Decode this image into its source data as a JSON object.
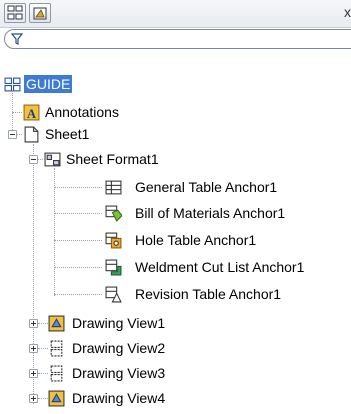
{
  "header": {
    "close_glyph": "x"
  },
  "tree": {
    "root": "GUIDE",
    "annotations": "Annotations",
    "sheet1": "Sheet1",
    "sheet_format": "Sheet Format1",
    "anchors": [
      {
        "label": "General Table Anchor1",
        "icon": "general-table-icon"
      },
      {
        "label": "Bill of Materials Anchor1",
        "icon": "bom-icon"
      },
      {
        "label": "Hole Table Anchor1",
        "icon": "hole-table-icon"
      },
      {
        "label": "Weldment Cut List Anchor1",
        "icon": "weldment-icon"
      },
      {
        "label": "Revision Table Anchor1",
        "icon": "revision-table-icon"
      }
    ],
    "views": [
      {
        "label": "Drawing View1",
        "icon": "drawing-view-icon"
      },
      {
        "label": "Drawing View2",
        "icon": "drawing-view-broken-icon"
      },
      {
        "label": "Drawing View3",
        "icon": "drawing-view-broken-icon"
      },
      {
        "label": "Drawing View4",
        "icon": "drawing-view-icon"
      }
    ]
  },
  "colors": {
    "selection": "#3d7bd6",
    "tree_lines": "#9aa3ad"
  }
}
